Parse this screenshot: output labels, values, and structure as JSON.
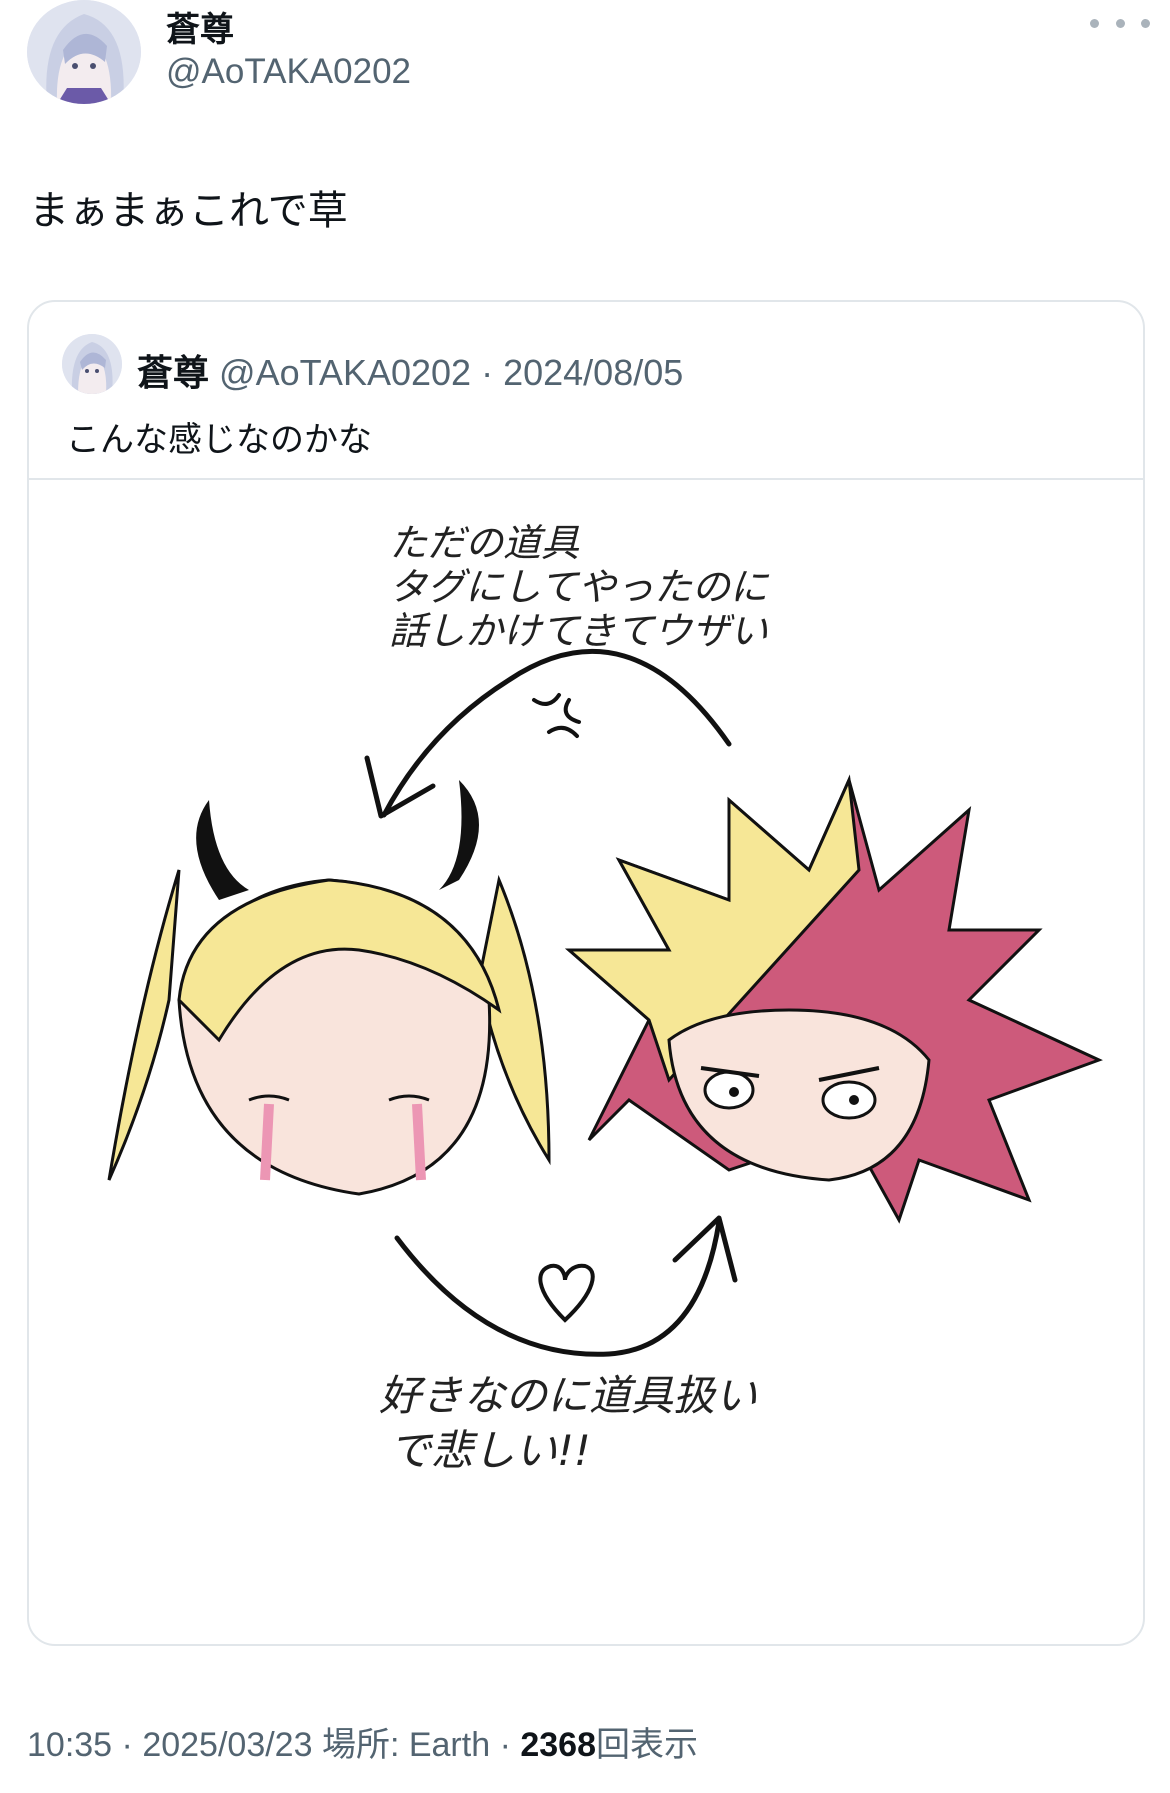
{
  "tweet": {
    "display_name": "蒼尊",
    "handle": "@AoTAKA0202",
    "text": "まぁまぁこれで草",
    "more_icon": "more-horizontal-icon"
  },
  "quote": {
    "display_name": "蒼尊",
    "handle": "@AoTAKA0202",
    "separator": "·",
    "date": "2024/08/05",
    "text": "こんな感じなのかな",
    "illustration": {
      "top_text_line1": "ただの道具",
      "top_text_line2": "タグにしてやったのに",
      "top_text_line3": "話しかけてきてウザい",
      "bottom_text_line1": "好きなのに道具扱い",
      "bottom_text_line2": "で悲しい!!"
    }
  },
  "footer": {
    "time": "10:35",
    "separator": "·",
    "date": "2025/03/23",
    "location_label": "場所: Earth",
    "views": "2368",
    "views_label": "回表示"
  },
  "colors": {
    "text_primary": "#0f1419",
    "text_secondary": "#536471",
    "border": "#e1e6ea",
    "hair_yellow": "#f6e796",
    "hair_red": "#cd5a7b",
    "skin": "#f9e4dc"
  }
}
